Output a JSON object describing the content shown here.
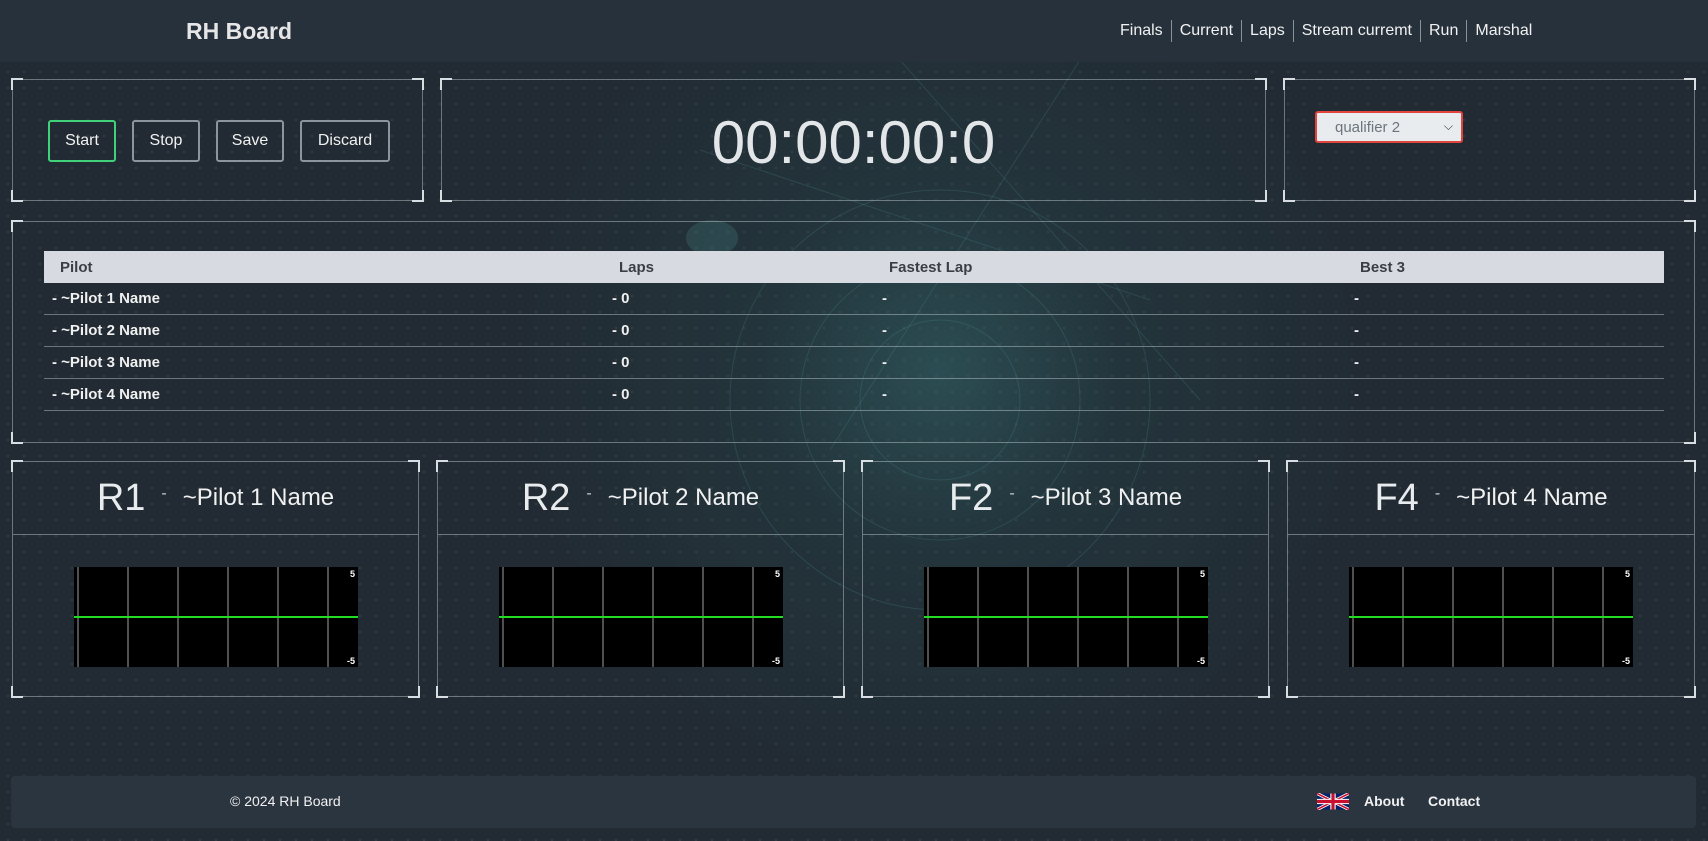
{
  "brand": "RH Board",
  "nav": [
    "Finals",
    "Current",
    "Laps",
    "Stream curremt",
    "Run",
    "Marshal"
  ],
  "controls": {
    "start": "Start",
    "stop": "Stop",
    "save": "Save",
    "discard": "Discard"
  },
  "timer": "00:00:00:0",
  "race_select": {
    "value": "qualifier 2"
  },
  "table": {
    "headers": [
      "Pilot",
      "Laps",
      "Fastest Lap",
      "Best 3"
    ],
    "rows": [
      [
        "- ~Pilot 1 Name",
        "- 0",
        "-",
        "-"
      ],
      [
        "- ~Pilot 2 Name",
        "- 0",
        "-",
        "-"
      ],
      [
        "- ~Pilot 3 Name",
        "- 0",
        "-",
        "-"
      ],
      [
        "- ~Pilot 4 Name",
        "- 0",
        "-",
        "-"
      ]
    ]
  },
  "pilots": [
    {
      "channel": "R1",
      "sep": "-",
      "name": "~Pilot 1 Name",
      "scale_max": "5",
      "scale_min": "-5"
    },
    {
      "channel": "R2",
      "sep": "-",
      "name": "~Pilot 2 Name",
      "scale_max": "5",
      "scale_min": "-5"
    },
    {
      "channel": "F2",
      "sep": "-",
      "name": "~Pilot 3 Name",
      "scale_max": "5",
      "scale_min": "-5"
    },
    {
      "channel": "F4",
      "sep": "-",
      "name": "~Pilot 4 Name",
      "scale_max": "5",
      "scale_min": "-5"
    }
  ],
  "footer": {
    "copyright": "© 2024 RH Board",
    "about": "About",
    "contact": "Contact",
    "flag_icon": "uk-flag-icon"
  },
  "colors": {
    "start_border": "#3fd27a",
    "select_border": "#e0453d",
    "signal_line": "#22dd22"
  }
}
